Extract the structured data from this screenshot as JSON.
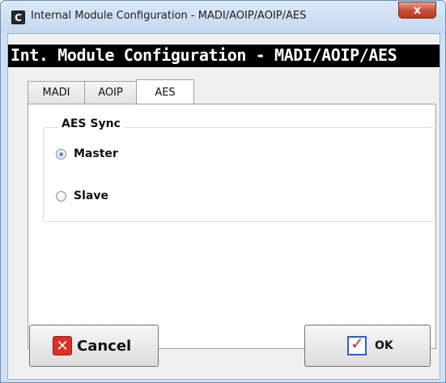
{
  "window": {
    "app_icon_letter": "C",
    "title": "Internal Module Configuration - MADI/AOIP/AOIP/AES",
    "close_glyph": "x"
  },
  "header": {
    "title": "Int. Module Configuration - MADI/AOIP/AES"
  },
  "tabs": [
    {
      "label": "MADI",
      "active": false
    },
    {
      "label": "AOIP",
      "active": false
    },
    {
      "label": "AES",
      "active": true
    }
  ],
  "aes_sync": {
    "group_title": "AES Sync",
    "options": [
      {
        "label": "Master",
        "checked": true
      },
      {
        "label": "Slave",
        "checked": false
      }
    ]
  },
  "buttons": {
    "cancel_label": "Cancel",
    "ok_label": "OK"
  },
  "icons": {
    "app": "app-icon",
    "close": "close-icon",
    "cancel": "cancel-x-icon",
    "ok": "checkmark-icon"
  },
  "colors": {
    "title_bar": "#c4d8ef",
    "header_bar": "#000000",
    "header_text": "#ffffff",
    "close_button": "#c74a32",
    "cancel_icon": "#d9302a",
    "ok_check": "#d7261c",
    "ok_box_border": "#2b61c4"
  }
}
